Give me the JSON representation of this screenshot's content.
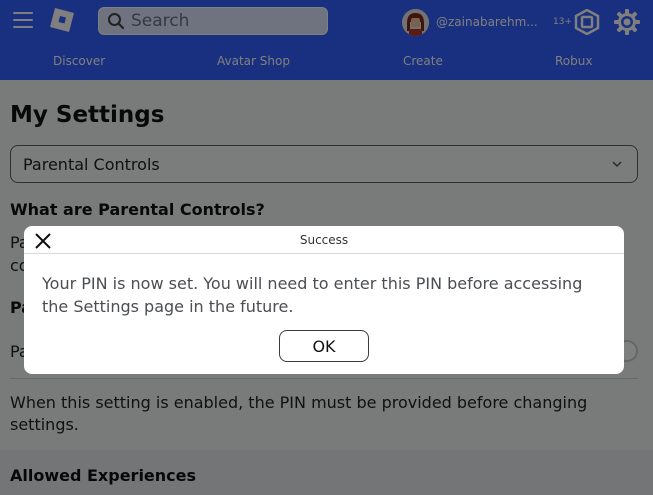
{
  "header": {
    "search": {
      "placeholder": "Search"
    },
    "user": {
      "username": "@zainabarehm...",
      "age_badge": "13+"
    },
    "nav": [
      "Discover",
      "Avatar Shop",
      "Create",
      "Robux"
    ]
  },
  "page": {
    "title": "My Settings",
    "selected_section": "Parental Controls",
    "heading_what": "What are Parental Controls?",
    "partial_line_1": "Pa",
    "partial_line_2": "co",
    "partial_heading": "Pa",
    "partial_setting": "Pa",
    "pin_description": "When this setting is enabled, the PIN must be provided before changing settings.",
    "heading_allowed": "Allowed Experiences"
  },
  "modal": {
    "title": "Success",
    "message": "Your PIN is now set. You will need to enter this PIN before accessing the Settings page in the future.",
    "ok_label": "OK"
  },
  "colors": {
    "header_blue": "#335fff",
    "overlay": "rgba(0,0,0,0.5)"
  },
  "icons": [
    "menu-icon",
    "roblox-logo-icon",
    "search-icon",
    "robux-icon",
    "gear-icon",
    "chevron-down-icon",
    "close-icon"
  ]
}
